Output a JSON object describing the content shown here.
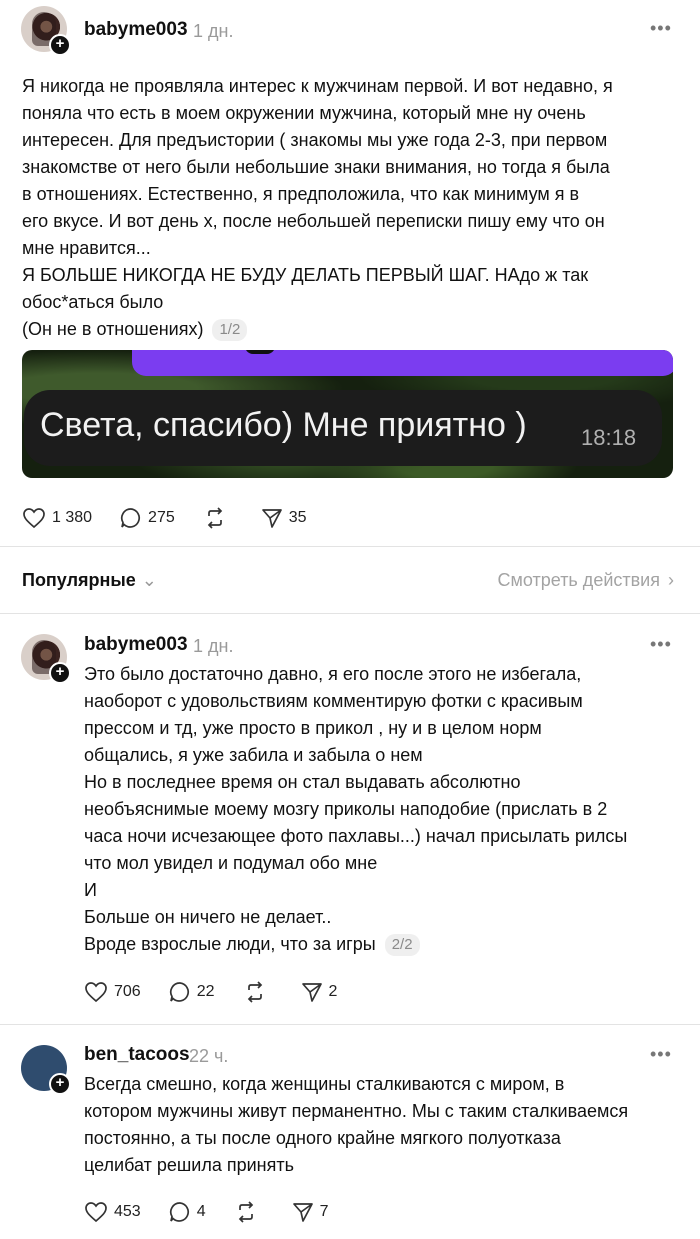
{
  "post": {
    "username": "babyme003",
    "time": "1 дн.",
    "more": "•••",
    "text": "Я никогда не проявляла интерес к мужчинам первой. И вот недавно, я\nпоняла что есть в моем окружении мужчина, который мне ну очень\nинтересен. Для предъистории ( знакомы мы уже года 2-3, при первом\nзнакомстве от него были небольшие знаки внимания, но тогда я была\nв отношениях. Естественно, я предположила, что как минимум я в\nего вкусе. И вот день х, после небольшей переписки пишу ему что он\nмне нравится...\nЯ БОЛЬШЕ НИКОГДА НЕ БУДУ ДЕЛАТЬ ПЕРВЫЙ ШАГ. НАдо ж так\nобос*аться было\n(Он не в отношениях)",
    "page": "1/2",
    "media": {
      "message": "Света, спасибо) Мне приятно )",
      "message_time": "18:18"
    },
    "likes": "1 380",
    "replies": "275",
    "shares": "35"
  },
  "sort": {
    "label": "Популярные",
    "chevron": "⌄",
    "activity_label": "Смотреть действия",
    "activity_chevron": "›"
  },
  "replies": [
    {
      "username": "babyme003",
      "time": "1 дн.",
      "avatar": "photo",
      "text": "Это было достаточно давно, я его после этого не избегала,\nнаоборот с удовольствиям комментирую фотки с красивым\nпрессом и тд, уже просто в прикол , ну и в целом норм\nобщались, я уже забила и забыла о нем\nНо в последнее время он стал выдавать абсолютно\nнеобъяснимые моему мозгу приколы наподобие (прислать в 2\nчаса ночи исчезающее фото пахлавы...) начал присылать рилсы\nчто мол увидел и подумал обо мне\nИ\nБольше он ничего не делает..\nВроде взрослые люди, что за игры",
      "page": "2/2",
      "likes": "706",
      "replies": "22",
      "shares": "2"
    },
    {
      "username": "ben_tacoos",
      "time": "22 ч.",
      "avatar": "blue",
      "text": "Всегда смешно, когда женщины сталкиваются с миром, в\nкотором мужчины живут перманентно. Мы с таким сталкиваемся\nпостоянно, а ты после одного крайне мягкого полуотказа\nцелибат решила принять",
      "page": "",
      "likes": "453",
      "replies": "4",
      "shares": "7"
    }
  ],
  "icons": {
    "like": "heart-icon",
    "reply": "comment-icon",
    "repost": "repost-icon",
    "share": "send-icon",
    "follow": "plus-icon",
    "more": "more-icon"
  },
  "colors": {
    "accent_purple": "#7b3df0",
    "muted_text": "#9a9a9a",
    "divider": "#e3e3e3"
  }
}
